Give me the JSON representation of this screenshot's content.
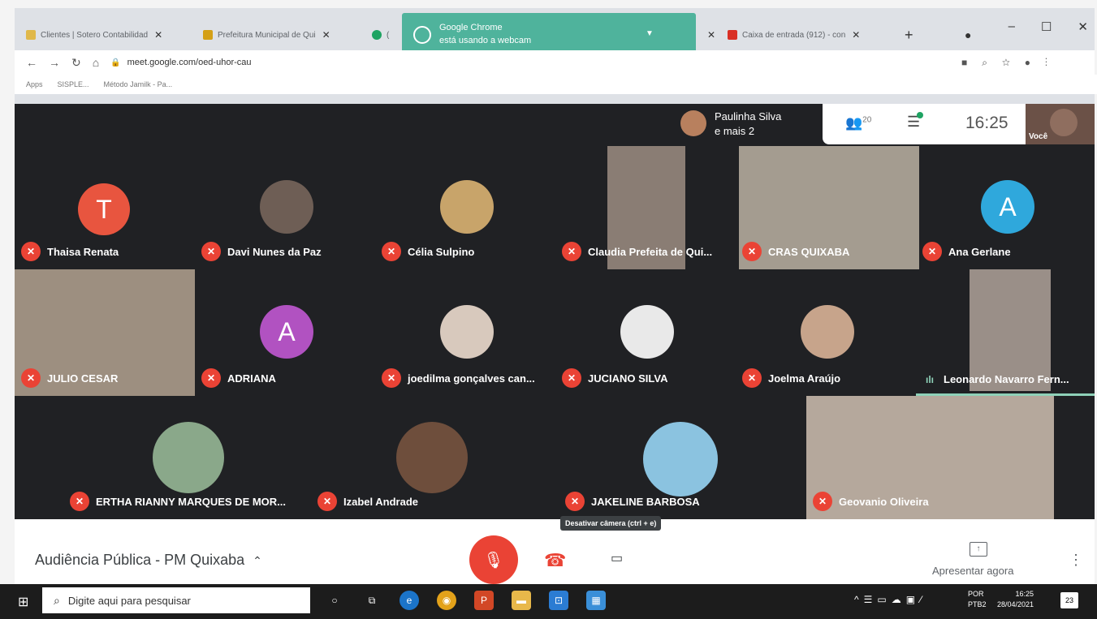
{
  "browser": {
    "tabs": [
      {
        "label": "Clientes | Sotero Contabilidad",
        "favicon_color": "#e0b84a"
      },
      {
        "label": "Prefeitura Municipal de Qui",
        "favicon_color": "#d4a017"
      },
      {
        "label": "(",
        "favicon_color": "#1ea362"
      },
      {
        "label": "Caixa de entrada (912) - con",
        "favicon_color": "#d93025"
      }
    ],
    "toast_line1": "Google Chrome",
    "toast_line2": "está usando a webcam",
    "url": "meet.google.com/oed-uhor-cau",
    "bookmarks": [
      "Apps",
      "SISPLE...",
      "Método Jamilk - Pa..."
    ]
  },
  "meet": {
    "header_name": "Paulinha Silva",
    "header_more": "e mais 2",
    "participant_count": "20",
    "time": "16:25",
    "self_label": "Você",
    "participants": [
      {
        "name": "Thaisa Renata",
        "letter": "T",
        "color": "#e8553f"
      },
      {
        "name": "Davi Nunes da Paz"
      },
      {
        "name": "Célia Sulpino"
      },
      {
        "name": "Claudia Prefeita de Qui..."
      },
      {
        "name": "CRAS QUIXABA"
      },
      {
        "name": "Ana Gerlane",
        "letter": "A",
        "color": "#2fa8dc"
      },
      {
        "name": "JULIO CESAR"
      },
      {
        "name": "ADRIANA",
        "letter": "A",
        "color": "#b152c1"
      },
      {
        "name": "joedilma gonçalves can..."
      },
      {
        "name": "JUCIANO SILVA"
      },
      {
        "name": "Joelma Araújo"
      },
      {
        "name": "Leonardo Navarro Fern..."
      },
      {
        "name": "ERTHA RIANNY MARQUES DE MOR..."
      },
      {
        "name": "Izabel Andrade"
      },
      {
        "name": "JAKELINE BARBOSA"
      },
      {
        "name": "Geovanio Oliveira"
      }
    ],
    "meeting_title": "Audiência Pública - PM Quixaba",
    "tooltip": "Desativar câmera (ctrl + e)",
    "present_label": "Apresentar agora"
  },
  "taskbar": {
    "search_placeholder": "Digite aqui para pesquisar",
    "lang1": "POR",
    "lang2": "PTB2",
    "time": "16:25",
    "date": "28/04/2021",
    "notifications": "23"
  }
}
